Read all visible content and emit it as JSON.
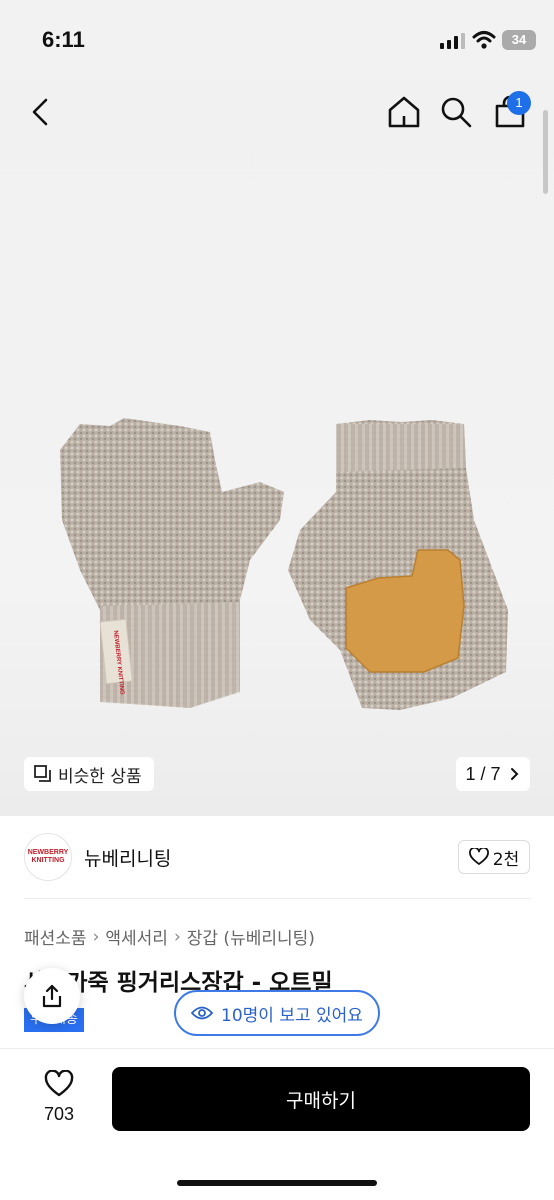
{
  "status_bar": {
    "time": "6:11",
    "battery": "34"
  },
  "nav": {
    "cart_badge": "1"
  },
  "gallery": {
    "similar_label": "비슷한 상품",
    "page_counter": "1 / 7",
    "product_image": "fingerless-gloves-oatmeal",
    "glove_label_text": "NEWBERRY KNITTING"
  },
  "brand": {
    "logo_text": "NEWBERRY KNITTING",
    "name": "뉴베리니팅",
    "likes": "2천"
  },
  "breadcrumb": [
    "패션소품",
    "액세서리",
    "장갑 (뉴베리니팅)"
  ],
  "product": {
    "title": "사슴가죽 핑거리스장갑 - 오트밀",
    "tag": "무료배송"
  },
  "viewers": {
    "text": "10명이 보고 있어요"
  },
  "bottom_bar": {
    "wish_count": "703",
    "buy_label": "구매하기"
  },
  "colors": {
    "accent": "#1e6fe8",
    "buy_button": "#000000",
    "pill_border": "#3d7ae5"
  }
}
